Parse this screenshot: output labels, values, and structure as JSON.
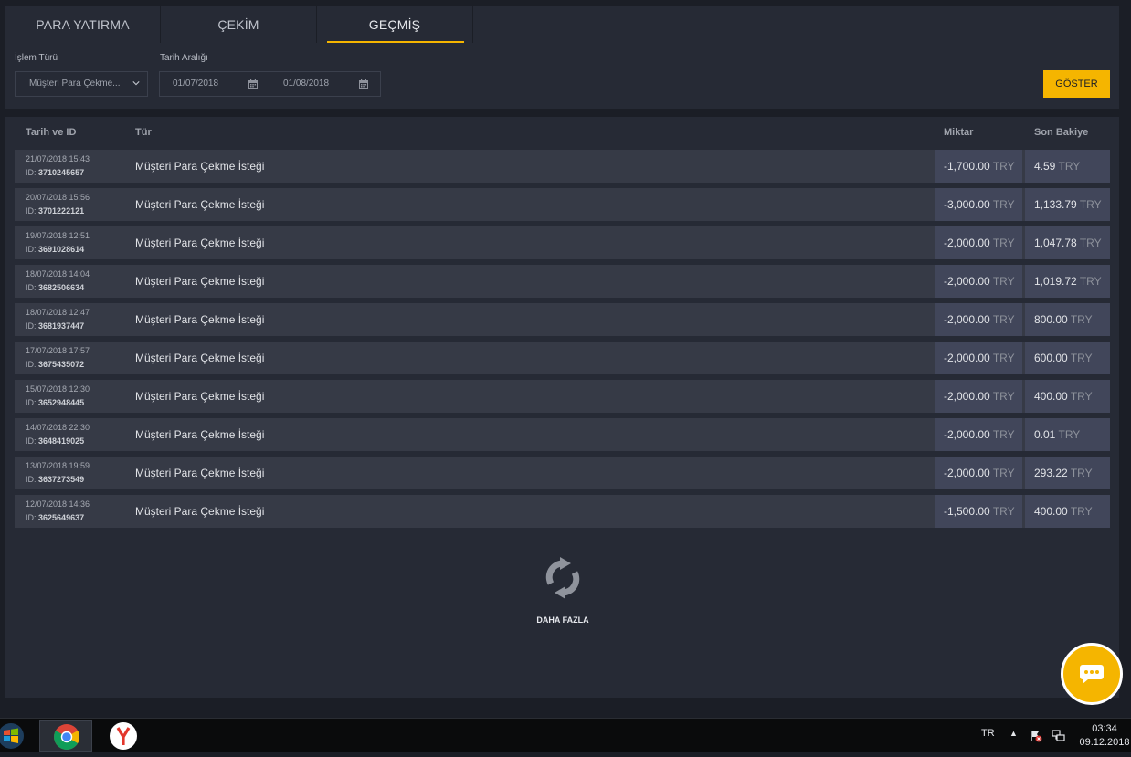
{
  "tabs": [
    {
      "label": "PARA YATIRMA"
    },
    {
      "label": "ÇEKİM"
    },
    {
      "label": "GEÇMİŞ"
    }
  ],
  "filters": {
    "type_label": "İşlem Türü",
    "type_value": "Müşteri Para Çekme...",
    "range_label": "Tarih Aralığı",
    "date_from": "01/07/2018",
    "date_to": "01/08/2018",
    "show_button": "GÖSTER"
  },
  "table": {
    "headers": {
      "date_id": "Tarih ve ID",
      "type": "Tür",
      "amount": "Miktar",
      "balance": "Son Bakiye"
    },
    "currency": "TRY",
    "id_prefix": "ID:",
    "rows": [
      {
        "date": "21/07/2018 15:43",
        "id": "3710245657",
        "type": "Müşteri Para Çekme İsteği",
        "amount": "-1,700.00",
        "balance": "4.59"
      },
      {
        "date": "20/07/2018 15:56",
        "id": "3701222121",
        "type": "Müşteri Para Çekme İsteği",
        "amount": "-3,000.00",
        "balance": "1,133.79"
      },
      {
        "date": "19/07/2018 12:51",
        "id": "3691028614",
        "type": "Müşteri Para Çekme İsteği",
        "amount": "-2,000.00",
        "balance": "1,047.78"
      },
      {
        "date": "18/07/2018 14:04",
        "id": "3682506634",
        "type": "Müşteri Para Çekme İsteği",
        "amount": "-2,000.00",
        "balance": "1,019.72"
      },
      {
        "date": "18/07/2018 12:47",
        "id": "3681937447",
        "type": "Müşteri Para Çekme İsteği",
        "amount": "-2,000.00",
        "balance": "800.00"
      },
      {
        "date": "17/07/2018 17:57",
        "id": "3675435072",
        "type": "Müşteri Para Çekme İsteği",
        "amount": "-2,000.00",
        "balance": "600.00"
      },
      {
        "date": "15/07/2018 12:30",
        "id": "3652948445",
        "type": "Müşteri Para Çekme İsteği",
        "amount": "-2,000.00",
        "balance": "400.00"
      },
      {
        "date": "14/07/2018 22:30",
        "id": "3648419025",
        "type": "Müşteri Para Çekme İsteği",
        "amount": "-2,000.00",
        "balance": "0.01"
      },
      {
        "date": "13/07/2018 19:59",
        "id": "3637273549",
        "type": "Müşteri Para Çekme İsteği",
        "amount": "-2,000.00",
        "balance": "293.22"
      },
      {
        "date": "12/07/2018 14:36",
        "id": "3625649637",
        "type": "Müşteri Para Çekme İsteği",
        "amount": "-1,500.00",
        "balance": "400.00"
      }
    ]
  },
  "load_more": "DAHA FAZLA",
  "taskbar": {
    "lang": "TR",
    "time": "03:34",
    "date": "09.12.2018"
  },
  "colors": {
    "accent": "#f5b500",
    "background": "#1b1e26",
    "panel": "#262a35"
  },
  "icons": [
    "calendar-icon",
    "chevron-down-icon",
    "refresh-icon",
    "chat-icon",
    "windows-start-icon",
    "chrome-icon",
    "yandex-icon",
    "flag-icon",
    "network-icon"
  ]
}
